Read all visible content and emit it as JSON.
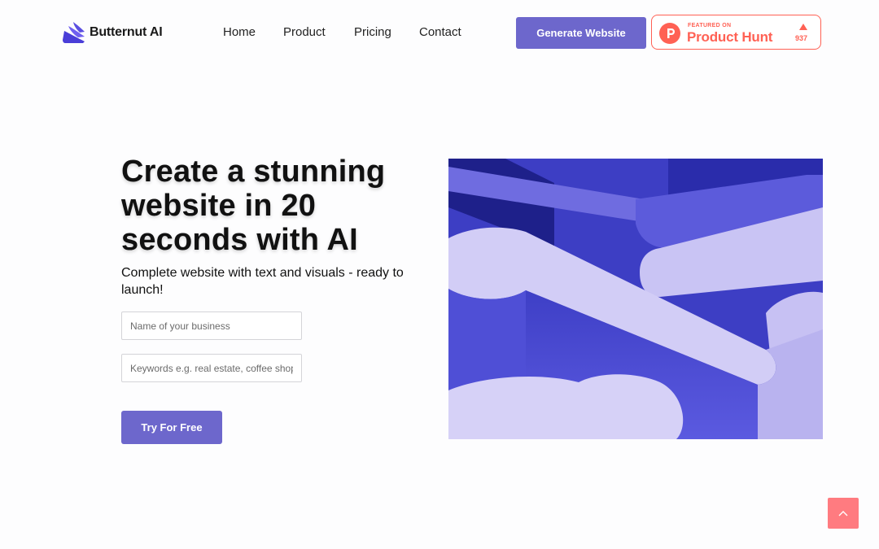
{
  "brand": {
    "name": "Butternut AI",
    "logo_icon": "stacked-wave-logo-icon",
    "accent_color": "#6d67cc"
  },
  "nav": {
    "links": [
      "Home",
      "Product",
      "Pricing",
      "Contact"
    ],
    "cta_label": "Generate Website"
  },
  "product_hunt": {
    "featured_label": "FEATURED ON",
    "name": "Product Hunt",
    "votes": "937",
    "color": "#ff6154",
    "icon": "product-hunt-logo-icon"
  },
  "hero": {
    "title": "Create a stunning website in 20 seconds with AI",
    "subtitle": "Complete website with text and visuals - ready to launch!",
    "business_placeholder": "Name of your business",
    "keywords_placeholder": "Keywords e.g. real estate, coffee shop",
    "submit_label": "Try For Free",
    "image": "abstract-3d-purple-shapes-illustration"
  },
  "scroll_top": {
    "icon": "chevron-up-icon",
    "color": "#ff7b80"
  }
}
